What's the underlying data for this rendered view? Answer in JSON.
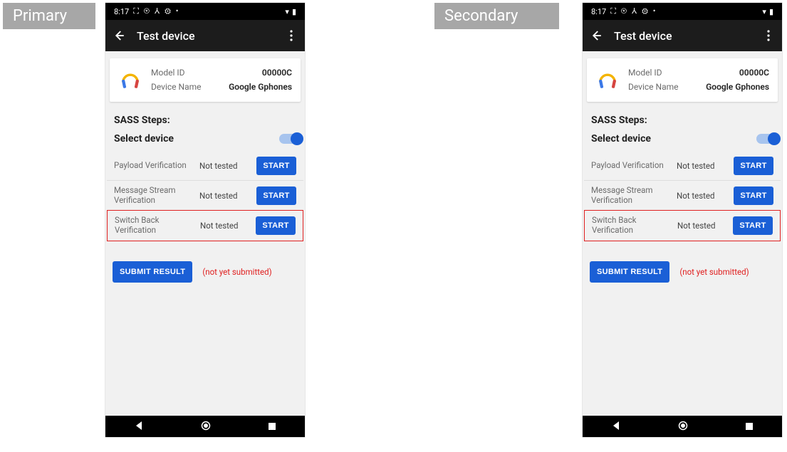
{
  "labels": {
    "primary": "Primary",
    "secondary": "Secondary"
  },
  "statusbar": {
    "time": "8:17",
    "icons_left": "⛶ ⊛ ⅄ ⚙ •",
    "icons_right": "📶 🔋"
  },
  "appbar": {
    "title": "Test device"
  },
  "card": {
    "model_id_label": "Model ID",
    "model_id_value": "00000C",
    "device_name_label": "Device Name",
    "device_name_value": "Google Gphones"
  },
  "section": {
    "steps_title": "SASS Steps:",
    "select_label": "Select device"
  },
  "tests": {
    "payload": {
      "name": "Payload Verification",
      "status": "Not tested",
      "btn": "START"
    },
    "msgstream": {
      "name": "Message Stream Verification",
      "status": "Not tested",
      "btn": "START"
    },
    "switchback": {
      "name": "Switch Back Verification",
      "status": "Not tested",
      "btn": "START"
    }
  },
  "submit": {
    "btn": "SUBMIT RESULT",
    "status": "(not yet submitted)"
  }
}
